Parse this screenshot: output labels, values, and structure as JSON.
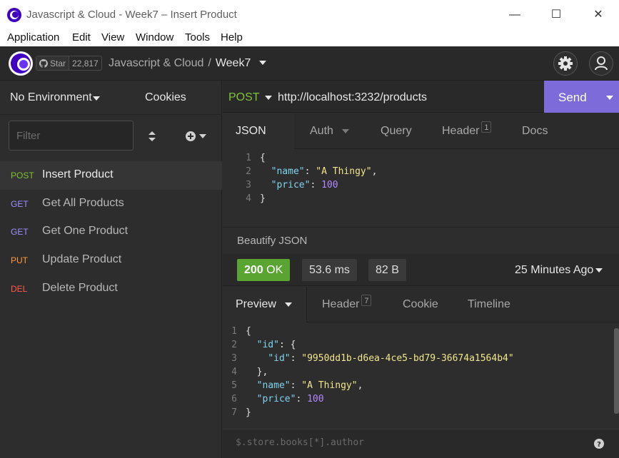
{
  "window": {
    "title": "Javascript & Cloud - Week7 – Insert Product"
  },
  "menu": [
    "Application",
    "Edit",
    "View",
    "Window",
    "Tools",
    "Help"
  ],
  "header": {
    "github_star_label": "Star",
    "github_star_count": "22,817",
    "workspace": "Javascript & Cloud",
    "separator": "/",
    "collection": "Week7"
  },
  "sidebar": {
    "environment": "No Environment",
    "cookies": "Cookies",
    "filter_placeholder": "Filter",
    "requests": [
      {
        "method": "POST",
        "method_color": "#7fc238",
        "name": "Insert Product"
      },
      {
        "method": "GET",
        "method_color": "#9d8fff",
        "name": "Get All Products"
      },
      {
        "method": "GET",
        "method_color": "#9d8fff",
        "name": "Get One Product"
      },
      {
        "method": "PUT",
        "method_color": "#ff9a3c",
        "name": "Update Product"
      },
      {
        "method": "DEL",
        "method_color": "#ff5a4a",
        "name": "Delete Product"
      }
    ]
  },
  "request": {
    "method": "POST",
    "url": "http://localhost:3232/products",
    "send_label": "Send",
    "tabs": [
      {
        "label": "JSON",
        "badge": ""
      },
      {
        "label": "Auth",
        "badge": ""
      },
      {
        "label": "Query",
        "badge": ""
      },
      {
        "label": "Header",
        "badge": "1"
      },
      {
        "label": "Docs",
        "badge": ""
      }
    ],
    "body_lines": [
      "1",
      "2",
      "3",
      "4"
    ],
    "beautify_label": "Beautify JSON"
  },
  "response": {
    "status_code": "200",
    "status_text": "OK",
    "time": "53.6 ms",
    "size": "82 B",
    "age": "25 Minutes Ago",
    "tabs": [
      {
        "label": "Preview",
        "badge": ""
      },
      {
        "label": "Header",
        "badge": "7"
      },
      {
        "label": "Cookie",
        "badge": ""
      },
      {
        "label": "Timeline",
        "badge": ""
      }
    ],
    "body_line_numbers": [
      "1",
      "2",
      "3",
      "4",
      "5",
      "6",
      "7"
    ],
    "id_value": "\"9950dd1b-d6ea-4ce5-bd79-36674a1564b4\"",
    "name_value": "\"A Thingy\"",
    "price_value": "100",
    "filter_placeholder": "$.store.books[*].author"
  },
  "request_body": {
    "name_value": "\"A Thingy\"",
    "price_value": "100"
  },
  "colors": {
    "accent": "#7e6bda",
    "status_ok": "#5aa532",
    "post": "#7fc238"
  },
  "icons": [
    "github-icon",
    "gear-icon",
    "user-icon",
    "chevron-down-icon",
    "sort-icon",
    "plus-circle-icon",
    "help-icon"
  ]
}
